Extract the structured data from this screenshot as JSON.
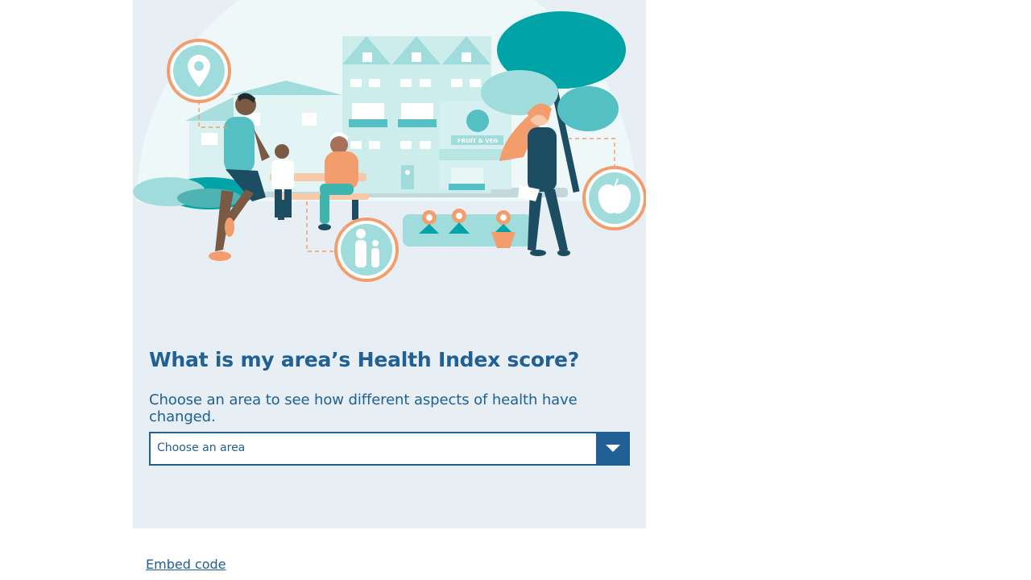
{
  "heading": "What is my area’s Health Index score?",
  "subheading": "Choose an area to see how different aspects of health have changed.",
  "area_select": {
    "placeholder": "Choose an area",
    "icon": "chevron-down-icon"
  },
  "embed_link": "Embed code",
  "illustration": {
    "shop_sign": "FRUIT & VEG"
  },
  "colors": {
    "primary": "#206095",
    "card_bg": "#e7eef4",
    "teal": "#00a3a6",
    "light_teal": "#9fdcdb",
    "orange": "#f29d6b"
  }
}
